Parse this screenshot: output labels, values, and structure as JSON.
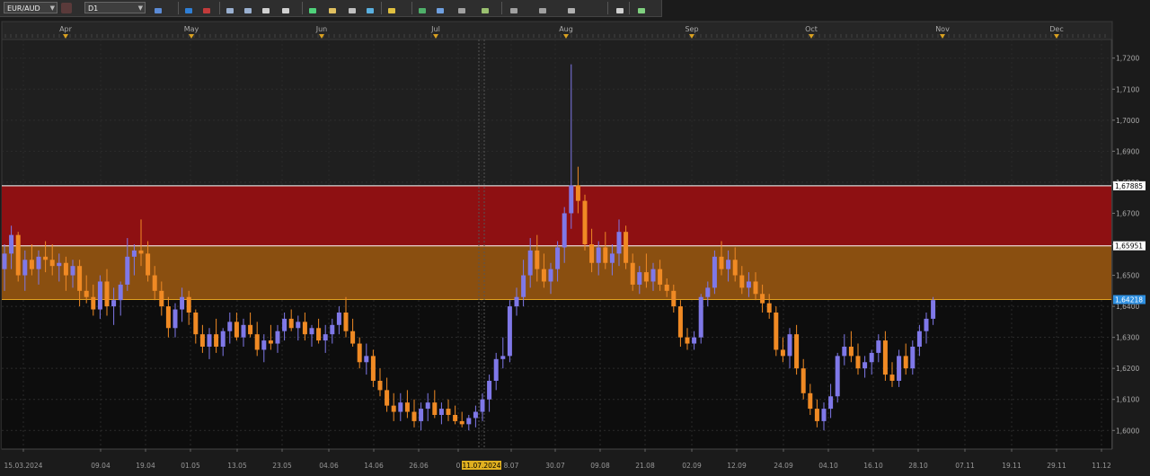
{
  "toolbar": {
    "symbol": "EUR/AUD",
    "timeframe": "D1",
    "tools": [
      "chart-type-icon",
      "horizontal-line-icon",
      "rectangle-zone-icon",
      "zoom-in-icon",
      "zoom-out-icon",
      "cursor-icon",
      "point-icon",
      "text-tool-icon",
      "template-icon",
      "refresh-icon",
      "globe-icon",
      "pencil-icon",
      "candles-icon",
      "indicator-table-icon",
      "fibonacci-icon",
      "channel-icon",
      "trendline-icon",
      "arrow-icon",
      "sphere-icon",
      "eraser-icon",
      "grid-dots-icon"
    ]
  },
  "chart_data": {
    "type": "candlestick",
    "symbol": "EUR/AUD",
    "timeframe": "D1",
    "ylim": [
      1.594,
      1.726
    ],
    "y_ticks": [
      "1,6000",
      "1,6100",
      "1,6200",
      "1,6300",
      "1,6400",
      "1,6500",
      "1,6600",
      "1,6700",
      "1,6800",
      "1,6900",
      "1,7000",
      "1,7100",
      "1,7200"
    ],
    "x_tick_labels": [
      "15.03.2024",
      "09.04",
      "19.04",
      "01.05",
      "13.05",
      "23.05",
      "04.06",
      "14.06",
      "26.06",
      "0",
      "11.07.2024",
      "8.07",
      "30.07",
      "09.08",
      "21.08",
      "02.09",
      "12.09",
      "24.09",
      "04.10",
      "16.10",
      "28.10",
      "07.11",
      "19.11",
      "29.11",
      "11.12"
    ],
    "month_labels": [
      "Apr",
      "May",
      "Jun",
      "Jul",
      "Aug",
      "Sep",
      "Oct",
      "Nov",
      "Dec"
    ],
    "crosshair_date": "11.07.2024",
    "zones": [
      {
        "name": "resistance-zone",
        "from": 1.6595,
        "to": 1.6789,
        "color": "#8e1012"
      },
      {
        "name": "support-zone",
        "from": 1.6422,
        "to": 1.6595,
        "color": "#8a4f10"
      }
    ],
    "level_labels": [
      {
        "value": 1.67885,
        "text": "1,67885",
        "bg": "#ffffff",
        "fg": "#000000",
        "line": "#ffffff"
      },
      {
        "value": 1.65951,
        "text": "1,65951",
        "bg": "#ffffff",
        "fg": "#000000",
        "line": "#ffffff"
      },
      {
        "value": 1.64218,
        "text": "1,64218",
        "bg": "#2e8fe0",
        "fg": "#ffffff",
        "line": "#e0a020"
      }
    ],
    "candles": [
      [
        1.652,
        1.66,
        1.645,
        1.657
      ],
      [
        1.657,
        1.666,
        1.652,
        1.663
      ],
      [
        1.663,
        1.664,
        1.648,
        1.65
      ],
      [
        1.65,
        1.658,
        1.645,
        1.655
      ],
      [
        1.655,
        1.66,
        1.65,
        1.652
      ],
      [
        1.652,
        1.658,
        1.647,
        1.656
      ],
      [
        1.656,
        1.661,
        1.651,
        1.655
      ],
      [
        1.655,
        1.66,
        1.65,
        1.653
      ],
      [
        1.653,
        1.657,
        1.648,
        1.654
      ],
      [
        1.654,
        1.656,
        1.645,
        1.65
      ],
      [
        1.65,
        1.655,
        1.646,
        1.653
      ],
      [
        1.653,
        1.655,
        1.64,
        1.645
      ],
      [
        1.645,
        1.65,
        1.641,
        1.643
      ],
      [
        1.643,
        1.647,
        1.637,
        1.639
      ],
      [
        1.639,
        1.65,
        1.636,
        1.648
      ],
      [
        1.648,
        1.652,
        1.637,
        1.64
      ],
      [
        1.64,
        1.646,
        1.634,
        1.642
      ],
      [
        1.642,
        1.648,
        1.637,
        1.647
      ],
      [
        1.647,
        1.662,
        1.645,
        1.656
      ],
      [
        1.656,
        1.66,
        1.65,
        1.658
      ],
      [
        1.658,
        1.668,
        1.653,
        1.657
      ],
      [
        1.657,
        1.661,
        1.648,
        1.65
      ],
      [
        1.65,
        1.653,
        1.642,
        1.645
      ],
      [
        1.645,
        1.648,
        1.637,
        1.64
      ],
      [
        1.64,
        1.643,
        1.63,
        1.633
      ],
      [
        1.633,
        1.641,
        1.63,
        1.639
      ],
      [
        1.639,
        1.646,
        1.635,
        1.643
      ],
      [
        1.643,
        1.645,
        1.634,
        1.638
      ],
      [
        1.638,
        1.639,
        1.628,
        1.631
      ],
      [
        1.631,
        1.634,
        1.625,
        1.627
      ],
      [
        1.627,
        1.633,
        1.623,
        1.631
      ],
      [
        1.631,
        1.636,
        1.625,
        1.627
      ],
      [
        1.627,
        1.633,
        1.624,
        1.632
      ],
      [
        1.632,
        1.638,
        1.628,
        1.635
      ],
      [
        1.635,
        1.638,
        1.629,
        1.63
      ],
      [
        1.63,
        1.636,
        1.627,
        1.634
      ],
      [
        1.634,
        1.638,
        1.63,
        1.631
      ],
      [
        1.631,
        1.635,
        1.624,
        1.626
      ],
      [
        1.626,
        1.631,
        1.622,
        1.629
      ],
      [
        1.629,
        1.634,
        1.626,
        1.628
      ],
      [
        1.628,
        1.634,
        1.625,
        1.632
      ],
      [
        1.632,
        1.638,
        1.629,
        1.636
      ],
      [
        1.636,
        1.639,
        1.632,
        1.633
      ],
      [
        1.633,
        1.637,
        1.629,
        1.635
      ],
      [
        1.635,
        1.638,
        1.629,
        1.631
      ],
      [
        1.631,
        1.634,
        1.627,
        1.633
      ],
      [
        1.633,
        1.636,
        1.628,
        1.629
      ],
      [
        1.629,
        1.634,
        1.625,
        1.631
      ],
      [
        1.631,
        1.636,
        1.628,
        1.634
      ],
      [
        1.634,
        1.64,
        1.631,
        1.638
      ],
      [
        1.638,
        1.643,
        1.63,
        1.632
      ],
      [
        1.632,
        1.636,
        1.627,
        1.628
      ],
      [
        1.628,
        1.63,
        1.62,
        1.622
      ],
      [
        1.622,
        1.628,
        1.618,
        1.624
      ],
      [
        1.624,
        1.626,
        1.614,
        1.616
      ],
      [
        1.616,
        1.62,
        1.611,
        1.613
      ],
      [
        1.613,
        1.617,
        1.606,
        1.608
      ],
      [
        1.608,
        1.612,
        1.603,
        1.606
      ],
      [
        1.606,
        1.612,
        1.603,
        1.609
      ],
      [
        1.609,
        1.613,
        1.604,
        1.606
      ],
      [
        1.606,
        1.61,
        1.601,
        1.603
      ],
      [
        1.603,
        1.609,
        1.6,
        1.607
      ],
      [
        1.607,
        1.612,
        1.603,
        1.609
      ],
      [
        1.609,
        1.613,
        1.604,
        1.605
      ],
      [
        1.605,
        1.609,
        1.602,
        1.607
      ],
      [
        1.607,
        1.61,
        1.603,
        1.605
      ],
      [
        1.605,
        1.608,
        1.602,
        1.603
      ],
      [
        1.603,
        1.606,
        1.601,
        1.602
      ],
      [
        1.602,
        1.605,
        1.6,
        1.604
      ],
      [
        1.604,
        1.608,
        1.601,
        1.606
      ],
      [
        1.606,
        1.612,
        1.603,
        1.61
      ],
      [
        1.61,
        1.618,
        1.606,
        1.616
      ],
      [
        1.616,
        1.625,
        1.613,
        1.623
      ],
      [
        1.623,
        1.63,
        1.62,
        1.624
      ],
      [
        1.624,
        1.642,
        1.622,
        1.64
      ],
      [
        1.64,
        1.646,
        1.637,
        1.643
      ],
      [
        1.643,
        1.655,
        1.64,
        1.65
      ],
      [
        1.65,
        1.662,
        1.646,
        1.658
      ],
      [
        1.658,
        1.663,
        1.648,
        1.652
      ],
      [
        1.652,
        1.657,
        1.646,
        1.648
      ],
      [
        1.648,
        1.654,
        1.644,
        1.652
      ],
      [
        1.652,
        1.661,
        1.648,
        1.659
      ],
      [
        1.659,
        1.672,
        1.654,
        1.67
      ],
      [
        1.67,
        1.718,
        1.665,
        1.679
      ],
      [
        1.679,
        1.685,
        1.67,
        1.674
      ],
      [
        1.674,
        1.676,
        1.658,
        1.66
      ],
      [
        1.66,
        1.665,
        1.651,
        1.654
      ],
      [
        1.654,
        1.661,
        1.65,
        1.659
      ],
      [
        1.659,
        1.664,
        1.652,
        1.654
      ],
      [
        1.654,
        1.66,
        1.65,
        1.657
      ],
      [
        1.657,
        1.668,
        1.653,
        1.664
      ],
      [
        1.664,
        1.666,
        1.652,
        1.654
      ],
      [
        1.654,
        1.657,
        1.645,
        1.647
      ],
      [
        1.647,
        1.653,
        1.644,
        1.651
      ],
      [
        1.651,
        1.657,
        1.646,
        1.648
      ],
      [
        1.648,
        1.654,
        1.645,
        1.652
      ],
      [
        1.652,
        1.655,
        1.645,
        1.647
      ],
      [
        1.647,
        1.649,
        1.643,
        1.645
      ],
      [
        1.645,
        1.647,
        1.638,
        1.64
      ],
      [
        1.64,
        1.642,
        1.627,
        1.63
      ],
      [
        1.63,
        1.633,
        1.626,
        1.628
      ],
      [
        1.628,
        1.632,
        1.626,
        1.63
      ],
      [
        1.63,
        1.644,
        1.628,
        1.643
      ],
      [
        1.643,
        1.648,
        1.64,
        1.646
      ],
      [
        1.646,
        1.658,
        1.644,
        1.656
      ],
      [
        1.656,
        1.661,
        1.65,
        1.652
      ],
      [
        1.652,
        1.658,
        1.648,
        1.655
      ],
      [
        1.655,
        1.659,
        1.648,
        1.65
      ],
      [
        1.65,
        1.653,
        1.644,
        1.646
      ],
      [
        1.646,
        1.651,
        1.643,
        1.648
      ],
      [
        1.648,
        1.651,
        1.642,
        1.644
      ],
      [
        1.644,
        1.647,
        1.638,
        1.641
      ],
      [
        1.641,
        1.644,
        1.636,
        1.638
      ],
      [
        1.638,
        1.64,
        1.624,
        1.626
      ],
      [
        1.626,
        1.63,
        1.622,
        1.624
      ],
      [
        1.624,
        1.633,
        1.62,
        1.631
      ],
      [
        1.631,
        1.634,
        1.618,
        1.62
      ],
      [
        1.62,
        1.623,
        1.61,
        1.612
      ],
      [
        1.612,
        1.615,
        1.605,
        1.607
      ],
      [
        1.607,
        1.61,
        1.601,
        1.603
      ],
      [
        1.603,
        1.609,
        1.6,
        1.607
      ],
      [
        1.607,
        1.615,
        1.604,
        1.611
      ],
      [
        1.611,
        1.625,
        1.609,
        1.624
      ],
      [
        1.624,
        1.631,
        1.621,
        1.627
      ],
      [
        1.627,
        1.632,
        1.622,
        1.624
      ],
      [
        1.624,
        1.628,
        1.618,
        1.62
      ],
      [
        1.62,
        1.624,
        1.617,
        1.622
      ],
      [
        1.622,
        1.626,
        1.618,
        1.625
      ],
      [
        1.625,
        1.631,
        1.622,
        1.629
      ],
      [
        1.629,
        1.632,
        1.616,
        1.618
      ],
      [
        1.618,
        1.622,
        1.614,
        1.616
      ],
      [
        1.616,
        1.626,
        1.614,
        1.624
      ],
      [
        1.624,
        1.628,
        1.618,
        1.62
      ],
      [
        1.62,
        1.629,
        1.618,
        1.627
      ],
      [
        1.627,
        1.634,
        1.624,
        1.632
      ],
      [
        1.632,
        1.638,
        1.628,
        1.636
      ],
      [
        1.636,
        1.643,
        1.634,
        1.642
      ]
    ]
  }
}
